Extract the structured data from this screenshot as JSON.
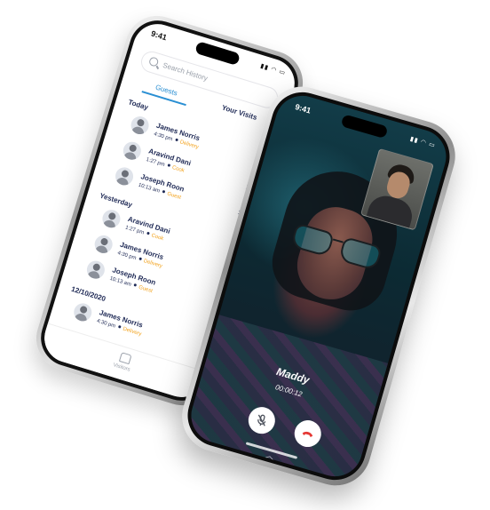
{
  "back_phone": {
    "status_time": "9:41",
    "search_placeholder": "Search History",
    "tabs": [
      {
        "label": "Guests",
        "active": true
      },
      {
        "label": "Your Visits",
        "active": false
      }
    ],
    "sections": [
      {
        "title": "Today",
        "rows": [
          {
            "name": "James Norris",
            "time": "4:30 pm",
            "type": "Delivery"
          },
          {
            "name": "Aravind Dani",
            "time": "1:27 pm",
            "type": "Cook"
          },
          {
            "name": "Joseph Roon",
            "time": "10:13 am",
            "type": "Guest"
          }
        ]
      },
      {
        "title": "Yesterday",
        "rows": [
          {
            "name": "Aravind Dani",
            "time": "1:27 pm",
            "type": "Cook"
          },
          {
            "name": "James Norris",
            "time": "4:30 pm",
            "type": "Delivery"
          },
          {
            "name": "Joseph Roon",
            "time": "10:13 am",
            "type": "Guest"
          }
        ]
      },
      {
        "title": "12/10/2020",
        "rows": [
          {
            "name": "James Norris",
            "time": "4:30 pm",
            "type": "Delivery"
          }
        ]
      }
    ],
    "bottom_nav_label": "Visitors"
  },
  "front_phone": {
    "status_time": "9:41",
    "caller_name": "Maddy",
    "call_duration": "00:00:12"
  },
  "colors": {
    "accent": "#2a8fd3",
    "text_primary": "#1f2a56",
    "type_label": "#f2a21c",
    "end_call": "#e53935"
  }
}
